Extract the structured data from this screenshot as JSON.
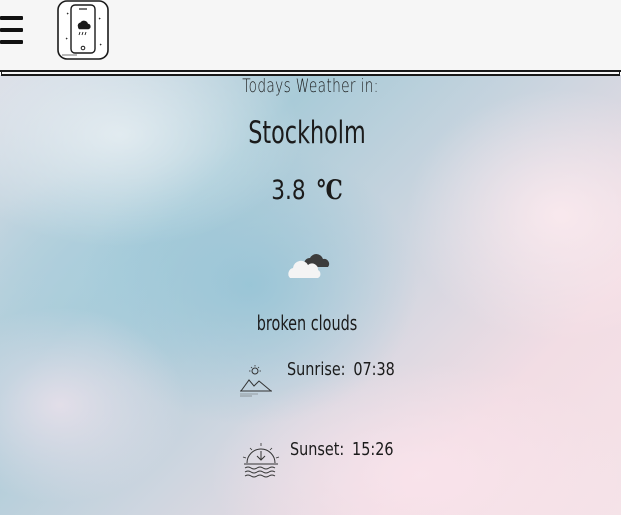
{
  "header": {
    "menu_icon": "hamburger-menu-icon",
    "logo_icon": "weather-phone-logo-icon"
  },
  "weather": {
    "heading": "Todays Weather in:",
    "city": "Stockholm",
    "temperature": "3.8",
    "unit": "℃",
    "condition_icon": "broken-clouds-icon",
    "description": "broken clouds",
    "sunrise_label": "Sunrise:",
    "sunrise_time": "07:38",
    "sunset_label": "Sunset:",
    "sunset_time": "15:26",
    "sunrise_icon": "sunrise-icon",
    "sunset_icon": "sunset-icon"
  },
  "colors": {
    "text": "#1b1b1b",
    "header_bg": "#f6f6f6",
    "logo_border": "#1a1a1a"
  }
}
